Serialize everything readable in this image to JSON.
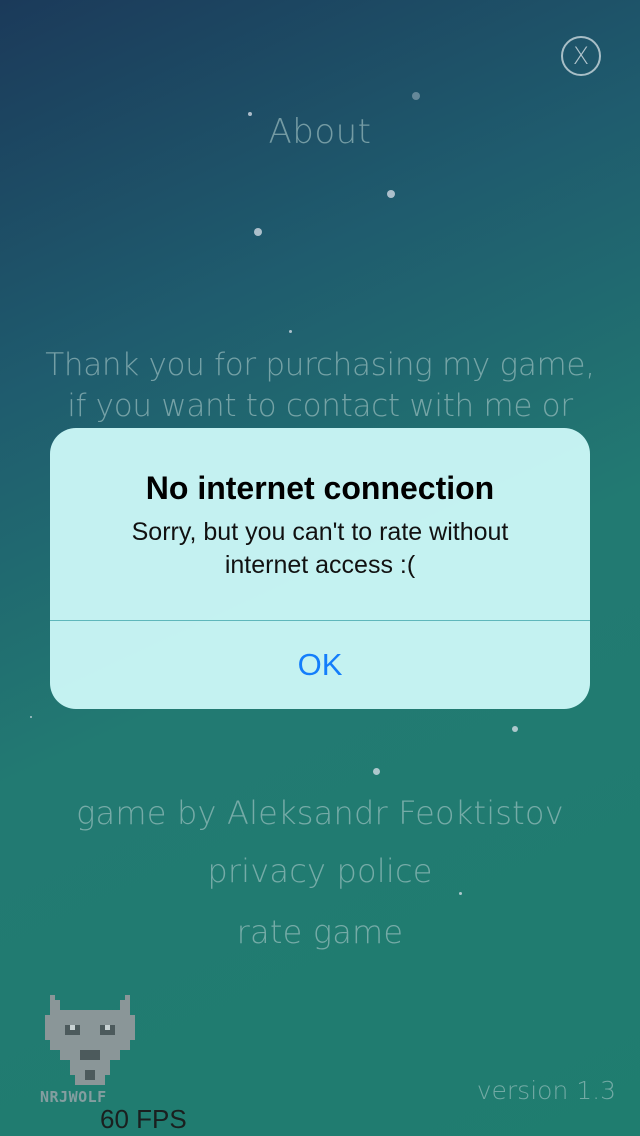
{
  "screen": {
    "close_symbol": "X",
    "about_title": "About",
    "thanks_line_1": "Thank you for purchasing my game,",
    "thanks_line_2": "if you want to contact with me or",
    "credit_author": "game by Aleksandr Feoktistov",
    "credit_privacy": "privacy police",
    "credit_rate": "rate game",
    "version": "version 1.3",
    "fps": "60 FPS",
    "logo_label": "NRJWOLF"
  },
  "alert": {
    "title": "No internet connection",
    "message": "Sorry, but you can't to rate without internet access :(",
    "ok_label": "OK"
  },
  "icons": {
    "close": "close-icon",
    "logo": "wolf-logo-icon"
  },
  "colors": {
    "alert_background": "#cbf7f7",
    "ok_button_text": "#147efb",
    "faded_text": "#aac8c8"
  }
}
